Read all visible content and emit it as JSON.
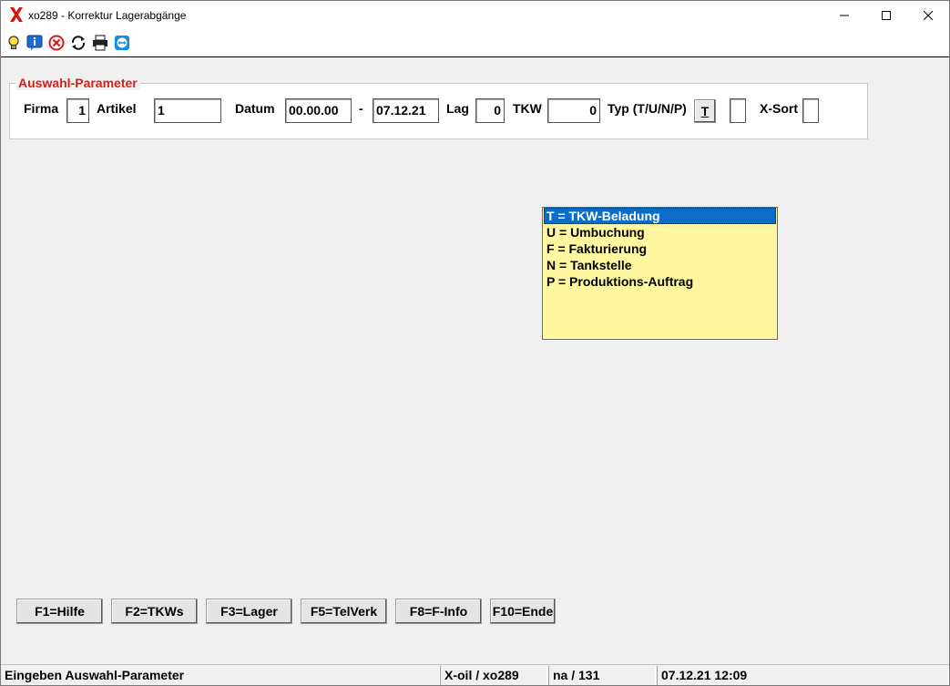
{
  "window": {
    "title": "xo289 - Korrektur Lagerabgänge",
    "app_icon": "x-logo-icon",
    "controls": [
      "minimize-icon",
      "maximize-icon",
      "close-icon"
    ]
  },
  "toolbar": {
    "icons": [
      "lightbulb-icon",
      "info-icon",
      "cancel-icon",
      "refresh-icon",
      "print-icon",
      "teamviewer-icon"
    ]
  },
  "params": {
    "legend": "Auswahl-Parameter",
    "firma_label": "Firma",
    "firma_value": "1",
    "artikel_label": "Artikel",
    "artikel_value": "1",
    "datum_label": "Datum",
    "datum_from": "00.00.00",
    "datum_sep": "-",
    "datum_to": "07.12.21",
    "lag_label": "Lag",
    "lag_value": "0",
    "tkw_label": "TKW",
    "tkw_value": "0",
    "typ_label": "Typ (T/U/N/P)",
    "typ_value": "T",
    "typ_extra_value": "",
    "xsort_label": "X-Sort",
    "xsort_value": ""
  },
  "typ_list": {
    "selected_index": 0,
    "items": [
      "T = TKW-Beladung",
      "U = Umbuchung",
      "F = Fakturierung",
      "N = Tankstelle",
      "P = Produktions-Auftrag"
    ]
  },
  "function_keys": [
    "F1=Hilfe",
    "F2=TKWs",
    "F3=Lager",
    "F5=TelVerk",
    "F8=F-Info",
    "F10=Ende"
  ],
  "status": {
    "message": "Eingeben Auswahl-Parameter",
    "system": "X-oil / xo289",
    "user": "na / 131",
    "datetime": "07.12.21 12:09"
  },
  "colors": {
    "legend": "#d0231b",
    "list_bg": "#fff79f",
    "list_selected": "#0b6dc7"
  }
}
